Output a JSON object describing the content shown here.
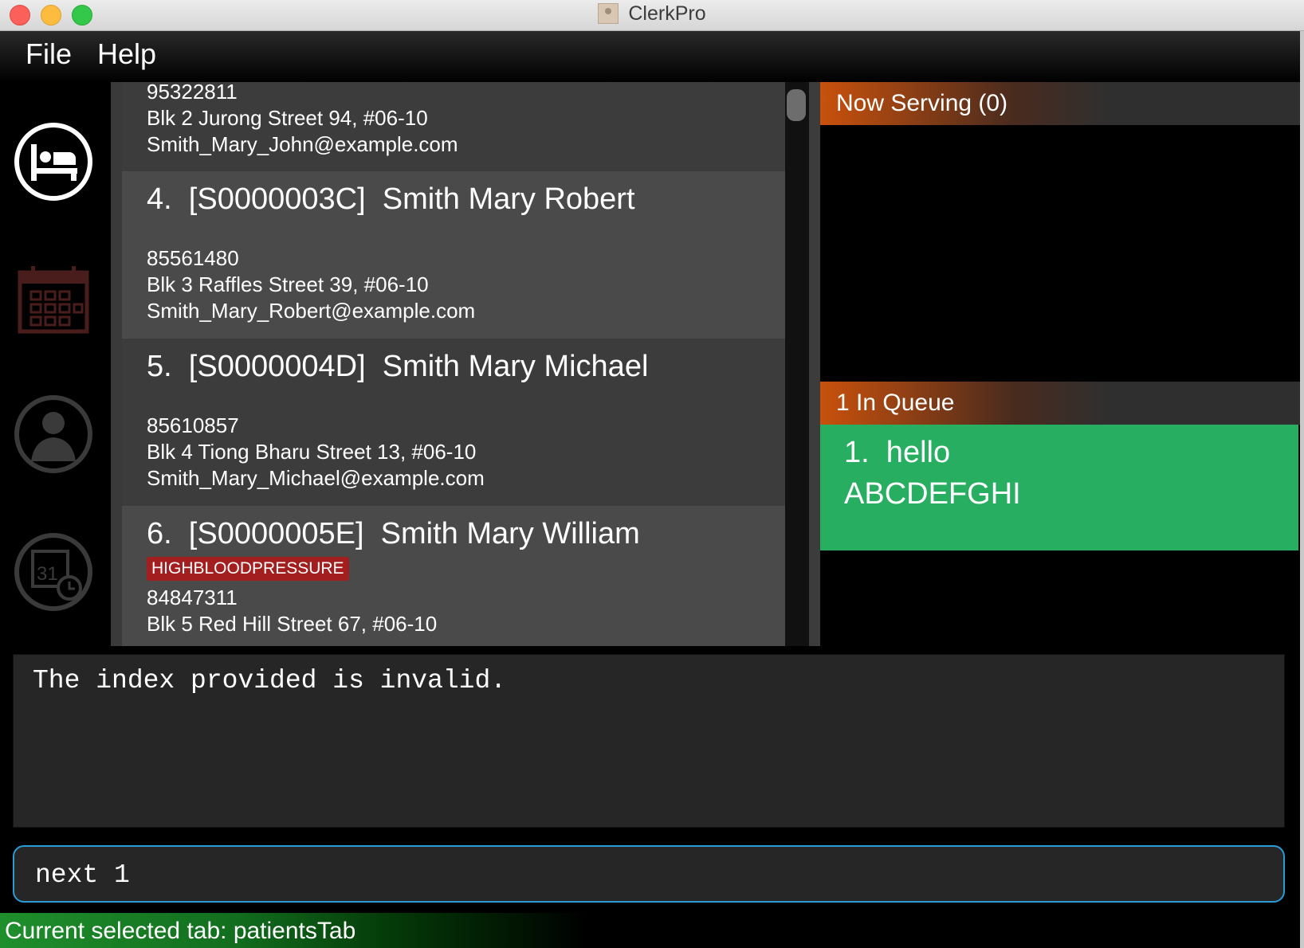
{
  "window": {
    "title": "ClerkPro"
  },
  "menu": {
    "file": "File",
    "help": "Help"
  },
  "sidebar": {
    "items": [
      {
        "icon": "patient-bed-icon",
        "active": true
      },
      {
        "icon": "calendar-grid-icon",
        "active": false
      },
      {
        "icon": "doctor-icon",
        "active": false
      },
      {
        "icon": "appointment-clock-icon",
        "active": false
      }
    ]
  },
  "patients": {
    "partial": {
      "phone": "95322811",
      "address": "Blk 2 Jurong Street 94, #06-10",
      "email": "Smith_Mary_John@example.com"
    },
    "cards": [
      {
        "title": "4.  [S0000003C]  Smith Mary Robert",
        "phone": "85561480",
        "address": "Blk 3 Raffles Street 39, #06-10",
        "email": "Smith_Mary_Robert@example.com"
      },
      {
        "title": "5.  [S0000004D]  Smith Mary Michael",
        "phone": "85610857",
        "address": "Blk 4 Tiong Bharu Street 13, #06-10",
        "email": "Smith_Mary_Michael@example.com"
      },
      {
        "title": "6.  [S0000005E]  Smith Mary William",
        "tag": "HIGHBLOODPRESSURE",
        "phone": "84847311",
        "address": "Blk 5 Red Hill Street 67, #06-10"
      }
    ]
  },
  "serving": {
    "title": "Now Serving (0)"
  },
  "queue": {
    "title": "1 In Queue",
    "items": [
      {
        "line1": "1.  hello",
        "line2": "ABCDEFGHI"
      }
    ]
  },
  "result": {
    "text": "The index provided is invalid."
  },
  "command": {
    "value": "next 1"
  },
  "status": {
    "text": "Current selected tab: patientsTab"
  },
  "colors": {
    "accent_orange": "#c9510c",
    "queue_green": "#27ae60",
    "tag_red": "#a31f1f",
    "command_border": "#2b9bd6"
  }
}
